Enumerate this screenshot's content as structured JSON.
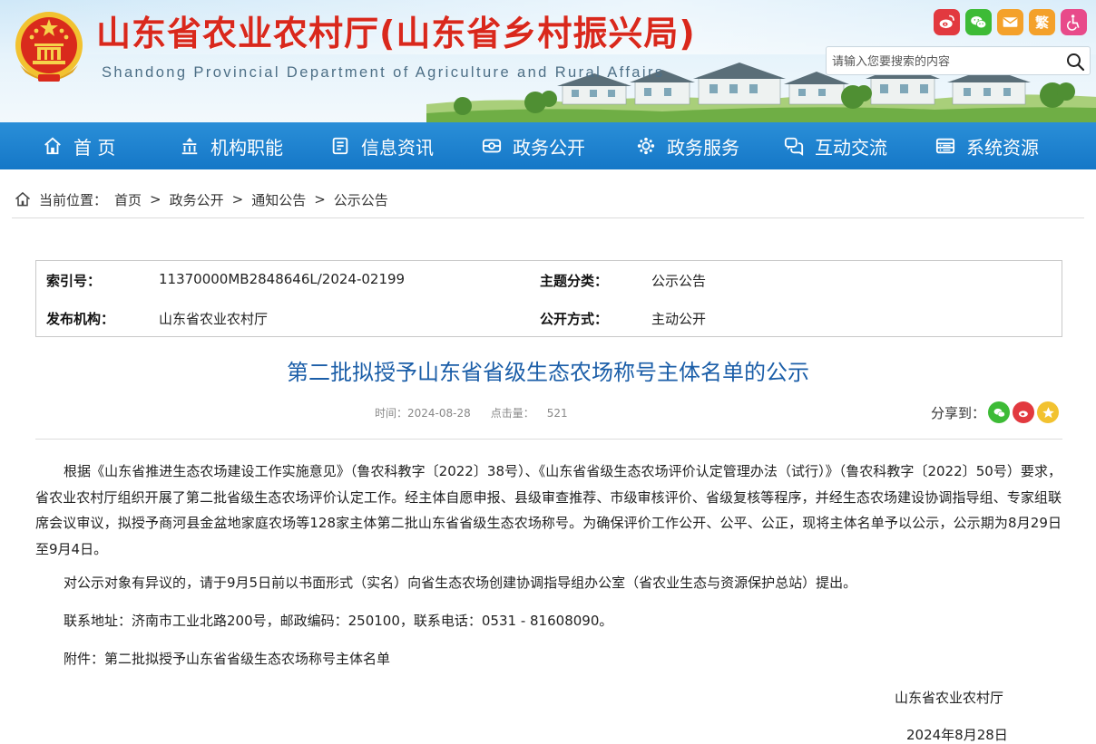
{
  "header": {
    "title": "山东省农业农村厅(山东省乡村振兴局)",
    "subtitle": "Shandong Provincial Department of Agriculture and Rural Affairs",
    "social": [
      {
        "name": "weibo-icon"
      },
      {
        "name": "wechat-icon"
      },
      {
        "name": "mail-icon"
      },
      {
        "name": "traditional-chinese-toggle",
        "label": "繁"
      },
      {
        "name": "accessibility-icon"
      }
    ],
    "search": {
      "placeholder": "请输入您要搜索的内容"
    }
  },
  "nav": {
    "items": [
      {
        "label": "首 页",
        "icon": "home-icon"
      },
      {
        "label": "机构职能",
        "icon": "org-icon"
      },
      {
        "label": "信息资讯",
        "icon": "document-icon"
      },
      {
        "label": "政务公开",
        "icon": "monitor-icon"
      },
      {
        "label": "政务服务",
        "icon": "service-icon"
      },
      {
        "label": "互动交流",
        "icon": "chat-icon"
      },
      {
        "label": "系统资源",
        "icon": "database-icon"
      }
    ]
  },
  "breadcrumb": {
    "prefix": "当前位置：",
    "items": [
      "首页",
      "政务公开",
      "通知公告",
      "公示公告"
    ],
    "separator": ">"
  },
  "meta": {
    "index_label": "索引号：",
    "index_value": "11370000MB2848646L/2024-02199",
    "topic_label": "主题分类：",
    "topic_value": "公示公告",
    "publisher_label": "发布机构：",
    "publisher_value": "山东省农业农村厅",
    "mode_label": "公开方式：",
    "mode_value": "主动公开"
  },
  "article": {
    "title": "第二批拟授予山东省省级生态农场称号主体名单的公示",
    "time": "时间：2024-08-28",
    "hits_label": "点击量：",
    "hits_value": "521",
    "share_label": "分享到：",
    "paragraphs": [
      "根据《山东省推进生态农场建设工作实施意见》（鲁农科教字〔2022〕38号）、《山东省省级生态农场评价认定管理办法（试行）》（鲁农科教字〔2022〕50号）要求，省农业农村厅组织开展了第二批省级生态农场评价认定工作。经主体自愿申报、县级审查推荐、市级审核评价、省级复核等程序，并经生态农场建设协调指导组、专家组联席会议审议，拟授予商河县金盆地家庭农场等128家主体第二批山东省省级生态农场称号。为确保评价工作公开、公平、公正，现将主体名单予以公示，公示期为8月29日至9月4日。",
      "对公示对象有异议的，请于9月5日前以书面形式（实名）向省生态农场创建协调指导组办公室（省农业生态与资源保护总站）提出。",
      "联系地址：济南市工业北路200号，邮政编码：250100，联系电话：0531 - 81608090。",
      "附件：第二批拟授予山东省省级生态农场称号主体名单"
    ],
    "signature": "山东省农业农村厅",
    "date": "2024年8月28日"
  },
  "colors": {
    "title_red": "#d9281c",
    "nav_blue": "#1577c7",
    "article_title_blue": "#1b5ea8"
  }
}
